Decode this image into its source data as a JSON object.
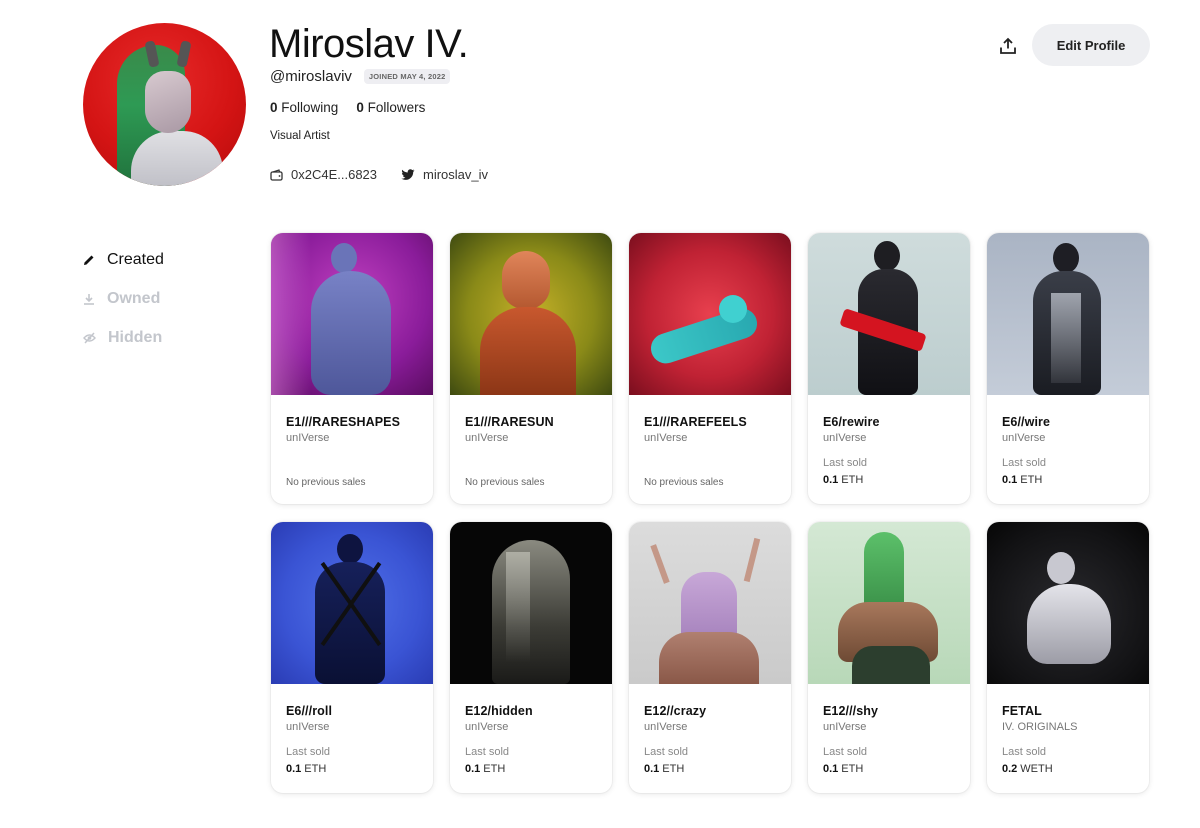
{
  "profile": {
    "name": "Miroslav IV.",
    "handle": "@miroslaviv",
    "joined": "JOINED MAY 4, 2022",
    "following_count": "0",
    "following_label": "Following",
    "followers_count": "0",
    "followers_label": "Followers",
    "bio": "Visual Artist",
    "wallet": "0x2C4E...6823",
    "twitter": "miroslav_iv"
  },
  "actions": {
    "edit_profile": "Edit Profile",
    "share_icon": "share-icon"
  },
  "nav": {
    "items": [
      {
        "label": "Created",
        "icon": "pencil-icon",
        "active": true
      },
      {
        "label": "Owned",
        "icon": "download-icon",
        "active": false
      },
      {
        "label": "Hidden",
        "icon": "eye-slash-icon",
        "active": false
      }
    ]
  },
  "cards": [
    {
      "title": "E1///RARESHAPES",
      "collection": "unIVerse",
      "no_sales": "No previous sales"
    },
    {
      "title": "E1///RARESUN",
      "collection": "unIVerse",
      "no_sales": "No previous sales"
    },
    {
      "title": "E1///RAREFEELS",
      "collection": "unIVerse",
      "no_sales": "No previous sales"
    },
    {
      "title": "E6/rewire",
      "collection": "unIVerse",
      "last_sold_label": "Last sold",
      "price": "0.1",
      "currency": "ETH"
    },
    {
      "title": "E6//wire",
      "collection": "unIVerse",
      "last_sold_label": "Last sold",
      "price": "0.1",
      "currency": "ETH"
    },
    {
      "title": "E6///roll",
      "collection": "unIVerse",
      "last_sold_label": "Last sold",
      "price": "0.1",
      "currency": "ETH"
    },
    {
      "title": "E12/hidden",
      "collection": "unIVerse",
      "last_sold_label": "Last sold",
      "price": "0.1",
      "currency": "ETH"
    },
    {
      "title": "E12//crazy",
      "collection": "unIVerse",
      "last_sold_label": "Last sold",
      "price": "0.1",
      "currency": "ETH"
    },
    {
      "title": "E12///shy",
      "collection": "unIVerse",
      "last_sold_label": "Last sold",
      "price": "0.1",
      "currency": "ETH"
    },
    {
      "title": "FETAL",
      "collection": "IV. ORIGINALS",
      "last_sold_label": "Last sold",
      "price": "0.2",
      "currency": "WETH"
    }
  ],
  "colors": {
    "accent_inactive": "#c3c6cc",
    "button_bg": "#eeeff2"
  }
}
